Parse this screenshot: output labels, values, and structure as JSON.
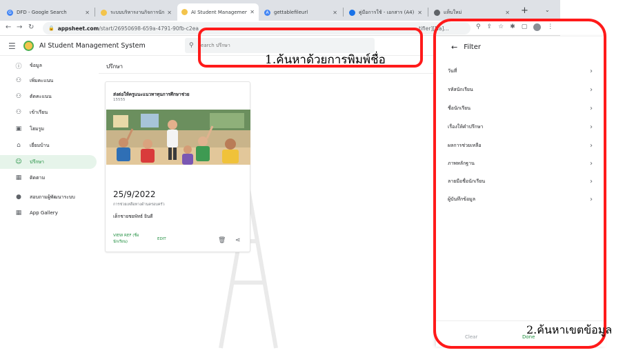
{
  "browser": {
    "tabs": [
      {
        "title": "DFD - Google Search",
        "icon": "google-icon",
        "color": "#4285f4",
        "active": false
      },
      {
        "title": "ระบบบริหารงานกิจการนักเรียน",
        "icon": "appsheet-icon",
        "color": "#f3c44c",
        "active": false
      },
      {
        "title": "AI Student Management Sy",
        "icon": "appsheet-icon",
        "color": "#f3c44c",
        "active": true
      },
      {
        "title": "gettablefileurl",
        "icon": "appsheet-a-icon",
        "color": "#4285f4",
        "active": false
      },
      {
        "title": "คู่มือการใช้ - เอกสาร (A4)",
        "icon": "docs-icon",
        "color": "#1a73e8",
        "active": false
      },
      {
        "title": "แท็บใหม่",
        "icon": "chrome-icon",
        "color": "#5f6368",
        "active": false
      }
    ],
    "new_tab_label": "+",
    "address": {
      "host": "appsheet.com",
      "path": "/start/26950698-659a-4791-90fb-c2ea"
    },
    "address_right": "tifier][Na]...",
    "address_suffix": "tifier][N..."
  },
  "app": {
    "title": "AI Student Management System",
    "search_placeholder": "Search ปรึกษา"
  },
  "sidebar": {
    "items": [
      {
        "label": "ข้อมูล",
        "icon": "info-circle-icon",
        "active": false
      },
      {
        "label": "เพิ่มคะแนน",
        "icon": "person-add-icon",
        "active": false
      },
      {
        "label": "ตัดคะแนน",
        "icon": "person-remove-icon",
        "active": false
      },
      {
        "label": "เข้าเรียน",
        "icon": "person-clock-icon",
        "active": false
      },
      {
        "label": "โฮมรูม",
        "icon": "classroom-icon",
        "active": false
      },
      {
        "label": "เยี่ยมบ้าน",
        "icon": "people-home-icon",
        "active": false
      },
      {
        "label": "ปรึกษา",
        "icon": "consult-icon",
        "active": true
      },
      {
        "label": "ติดตาม",
        "icon": "calendar-icon",
        "active": false
      },
      {
        "label": "สอบถามผู้พัฒนาระบบ",
        "icon": "info-filled-icon",
        "active": false
      },
      {
        "label": "App Gallery",
        "icon": "grid-icon",
        "active": false
      }
    ]
  },
  "main": {
    "view_title": "ปรึกษา",
    "card": {
      "title": "ส่งต่อให้ครูแนะแนวทาทุนการศึกษาช่วย",
      "subtitle": "15555",
      "date": "25/9/2022",
      "description": "การช่วยเหลือทางด้านครอบครัว",
      "student": "เด็กชายชยพัทธ์ ยินดี",
      "view_ref_line1": "VIEW REF (ชื่อ",
      "view_ref_line2": "นักเรียน)",
      "edit_label": "EDIT"
    }
  },
  "filter": {
    "title": "Filter",
    "rows": [
      "วันที่",
      "รหัสนักเรียน",
      "ชื่อนักเรียน",
      "เรื่องให้คำปรึกษา",
      "ผลการช่วยเหลือ",
      "ภาพหลักฐาน",
      "ลายมือชื่อนักเรียน",
      "ผู้บันทึกข้อมูล"
    ],
    "clear_label": "Clear",
    "done_label": "Done"
  },
  "annotations": {
    "search_note": "1.ค้นหาด้วยการพิมพ์ชื่อ",
    "filter_note": "2.ค้นหาเขตข้อมูล",
    "color": "#ff1a1a"
  }
}
